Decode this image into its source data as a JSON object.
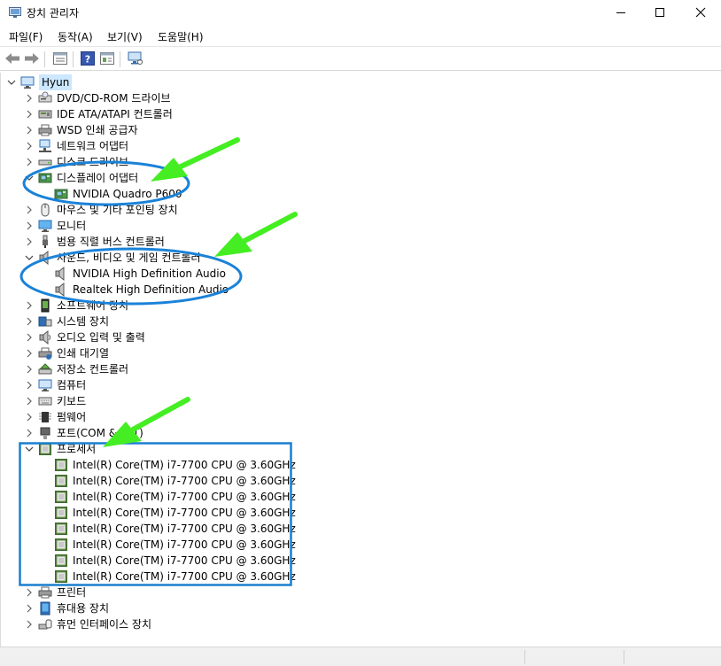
{
  "window": {
    "title": "장치 관리자"
  },
  "menu": [
    {
      "label": "파일(F)"
    },
    {
      "label": "동작(A)"
    },
    {
      "label": "보기(V)"
    },
    {
      "label": "도움말(H)"
    }
  ],
  "toolbar": {
    "icons": [
      "back-icon",
      "forward-icon",
      "properties-icon",
      "help-icon",
      "details-icon",
      "monitor-scan-icon"
    ]
  },
  "tree": {
    "root": {
      "label": "Hyun",
      "icon": "computer-icon"
    },
    "items": [
      {
        "label": "DVD/CD-ROM 드라이브",
        "icon": "dvd-drive-icon",
        "expanded": false
      },
      {
        "label": "IDE ATA/ATAPI 컨트롤러",
        "icon": "ide-controller-icon",
        "expanded": false
      },
      {
        "label": "WSD 인쇄 공급자",
        "icon": "wsd-printer-icon",
        "expanded": false
      },
      {
        "label": "네트워크 어댑터",
        "icon": "network-adapter-icon",
        "expanded": false
      },
      {
        "label": "디스크 드라이브",
        "icon": "disk-drive-icon",
        "expanded": false
      },
      {
        "label": "디스플레이 어댑터",
        "icon": "display-adapter-icon",
        "expanded": true,
        "children": [
          {
            "label": "NVIDIA Quadro P600",
            "icon": "display-adapter-icon"
          }
        ]
      },
      {
        "label": "마우스 및 기타 포인팅 장치",
        "icon": "mouse-icon",
        "expanded": false
      },
      {
        "label": "모니터",
        "icon": "monitor-icon",
        "expanded": false
      },
      {
        "label": "범용 직렬 버스 컨트롤러",
        "icon": "usb-icon",
        "expanded": false
      },
      {
        "label": "사운드, 비디오 및 게임 컨트롤러",
        "icon": "speaker-icon",
        "expanded": true,
        "children": [
          {
            "label": "NVIDIA High Definition Audio",
            "icon": "speaker-icon"
          },
          {
            "label": "Realtek High Definition Audio",
            "icon": "speaker-icon"
          }
        ]
      },
      {
        "label": "소프트웨어 장치",
        "icon": "software-device-icon",
        "expanded": false
      },
      {
        "label": "시스템 장치",
        "icon": "system-device-icon",
        "expanded": false
      },
      {
        "label": "오디오 입력 및 출력",
        "icon": "audio-io-icon",
        "expanded": false
      },
      {
        "label": "인쇄 대기열",
        "icon": "print-queue-icon",
        "expanded": false
      },
      {
        "label": "저장소 컨트롤러",
        "icon": "storage-controller-icon",
        "expanded": false
      },
      {
        "label": "컴퓨터",
        "icon": "computer-icon",
        "expanded": false
      },
      {
        "label": "키보드",
        "icon": "keyboard-icon",
        "expanded": false
      },
      {
        "label": "펌웨어",
        "icon": "firmware-icon",
        "expanded": false
      },
      {
        "label": "포트(COM & LPT)",
        "icon": "port-icon",
        "expanded": false
      },
      {
        "label": "프로세서",
        "icon": "processor-icon",
        "expanded": true,
        "children": [
          {
            "label": "Intel(R) Core(TM) i7-7700 CPU @ 3.60GHz",
            "icon": "processor-icon"
          },
          {
            "label": "Intel(R) Core(TM) i7-7700 CPU @ 3.60GHz",
            "icon": "processor-icon"
          },
          {
            "label": "Intel(R) Core(TM) i7-7700 CPU @ 3.60GHz",
            "icon": "processor-icon"
          },
          {
            "label": "Intel(R) Core(TM) i7-7700 CPU @ 3.60GHz",
            "icon": "processor-icon"
          },
          {
            "label": "Intel(R) Core(TM) i7-7700 CPU @ 3.60GHz",
            "icon": "processor-icon"
          },
          {
            "label": "Intel(R) Core(TM) i7-7700 CPU @ 3.60GHz",
            "icon": "processor-icon"
          },
          {
            "label": "Intel(R) Core(TM) i7-7700 CPU @ 3.60GHz",
            "icon": "processor-icon"
          },
          {
            "label": "Intel(R) Core(TM) i7-7700 CPU @ 3.60GHz",
            "icon": "processor-icon"
          }
        ]
      },
      {
        "label": "프린터",
        "icon": "printer-icon",
        "expanded": false
      },
      {
        "label": "휴대용 장치",
        "icon": "portable-device-icon",
        "expanded": false
      },
      {
        "label": "휴먼 인터페이스 장치",
        "icon": "hid-icon",
        "expanded": false
      }
    ]
  },
  "colors": {
    "selection": "#cce8ff",
    "annotation_arrow": "#44ee22",
    "annotation_ellipse": "#1a82d8",
    "annotation_box": "#1a7fd0"
  }
}
